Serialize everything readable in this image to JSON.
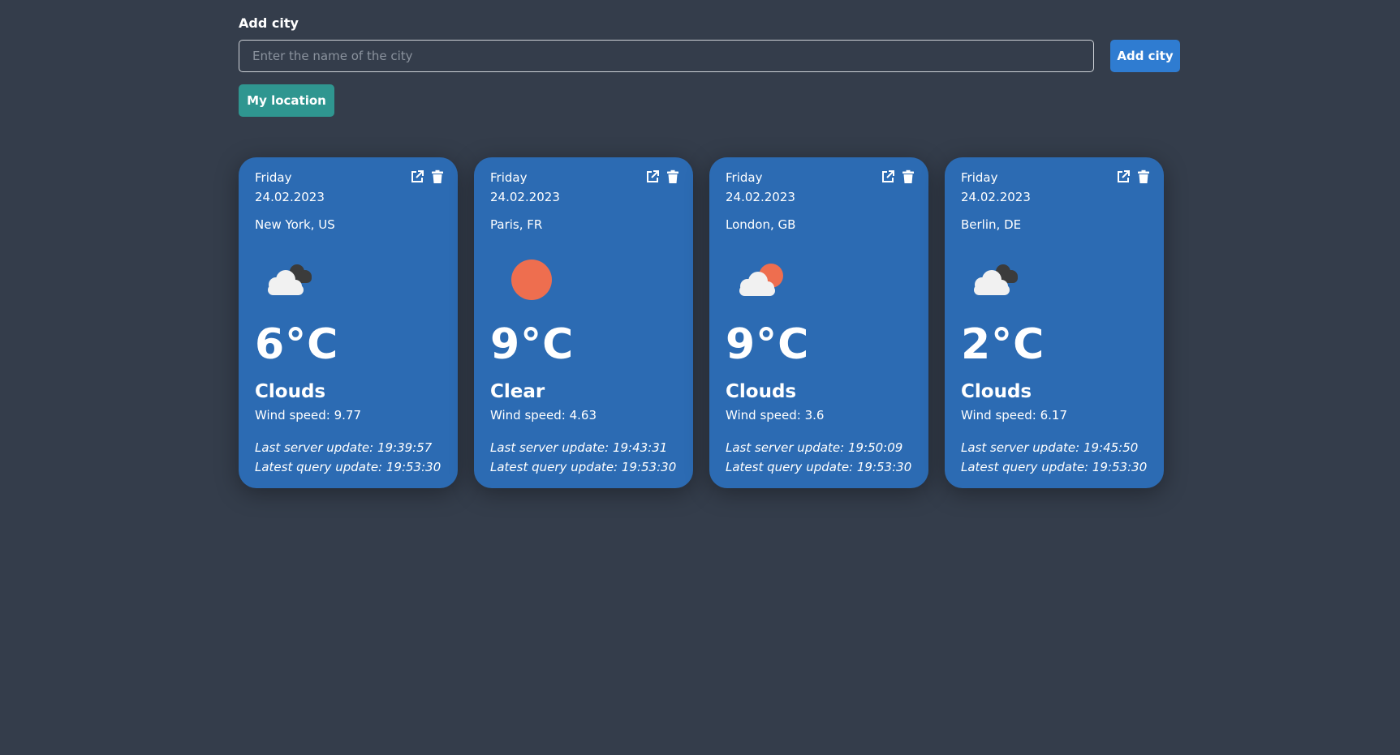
{
  "form": {
    "label": "Add city",
    "placeholder": "Enter the name of the city",
    "add_button": "Add city",
    "location_button": "My location"
  },
  "icons": {
    "open": "external-link-icon",
    "delete": "trash-icon"
  },
  "colors": {
    "background": "#343d4b",
    "card": "#2c6bb3",
    "add_button": "#2f7cd1",
    "location_button": "#2f9690",
    "sun": "#ee6e4f"
  },
  "cards": [
    {
      "day": "Friday",
      "date": "24.02.2023",
      "city": "New York, US",
      "icon": "cloud-dark-icon",
      "temp": "6°C",
      "condition": "Clouds",
      "wind": "Wind speed: 9.77",
      "server_update": "Last server update: 19:39:57",
      "query_update": "Latest query update: 19:53:30"
    },
    {
      "day": "Friday",
      "date": "24.02.2023",
      "city": "Paris, FR",
      "icon": "sun-icon",
      "temp": "9°C",
      "condition": "Clear",
      "wind": "Wind speed: 4.63",
      "server_update": "Last server update: 19:43:31",
      "query_update": "Latest query update: 19:53:30"
    },
    {
      "day": "Friday",
      "date": "24.02.2023",
      "city": "London, GB",
      "icon": "cloud-sun-icon",
      "temp": "9°C",
      "condition": "Clouds",
      "wind": "Wind speed: 3.6",
      "server_update": "Last server update: 19:50:09",
      "query_update": "Latest query update: 19:53:30"
    },
    {
      "day": "Friday",
      "date": "24.02.2023",
      "city": "Berlin, DE",
      "icon": "cloud-dark-icon",
      "temp": "2°C",
      "condition": "Clouds",
      "wind": "Wind speed: 6.17",
      "server_update": "Last server update: 19:45:50",
      "query_update": "Latest query update: 19:53:30"
    }
  ]
}
